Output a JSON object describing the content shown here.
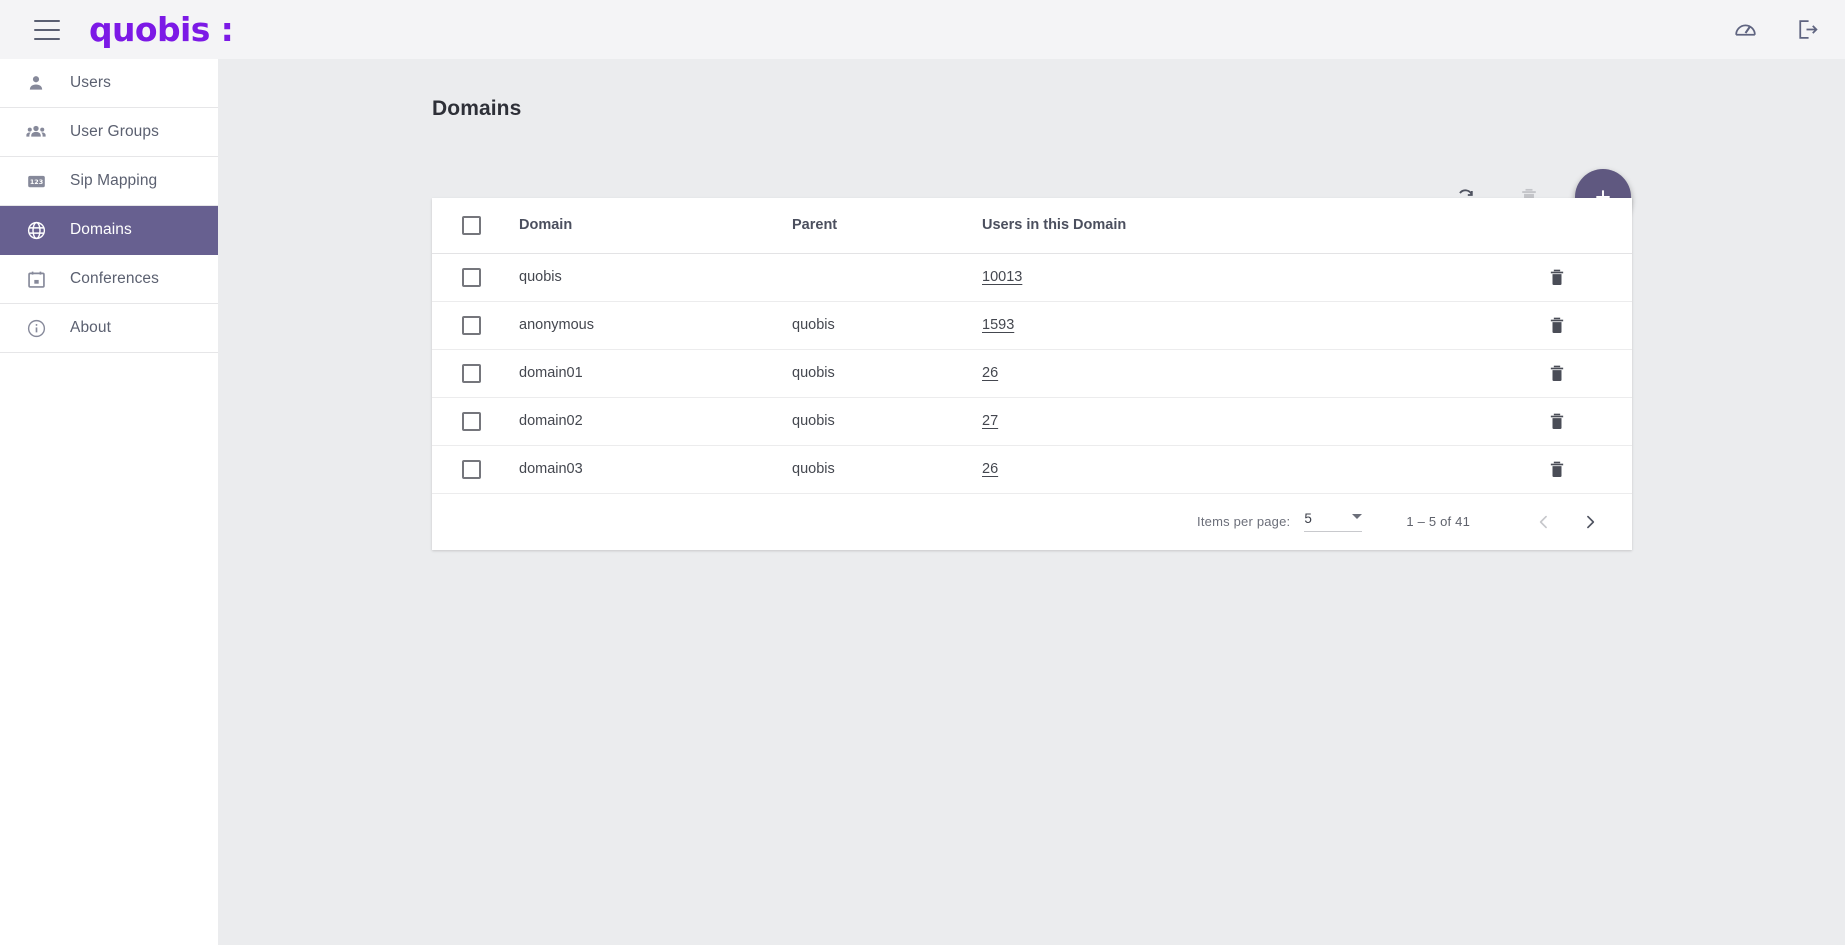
{
  "topbar": {
    "menu_icon": "hamburger-menu-icon",
    "logo_text": "quobis :",
    "actions": [
      {
        "name": "dashboard-gauge-icon",
        "label": "Dashboard"
      },
      {
        "name": "logout-icon",
        "label": "Logout"
      }
    ]
  },
  "sidebar": {
    "items": [
      {
        "label": "Users",
        "icon": "person-icon",
        "active": false
      },
      {
        "label": "User Groups",
        "icon": "people-icon",
        "active": false
      },
      {
        "label": "Sip Mapping",
        "icon": "123-icon",
        "active": false
      },
      {
        "label": "Domains",
        "icon": "globe-icon",
        "active": true
      },
      {
        "label": "Conferences",
        "icon": "calendar-icon",
        "active": false
      },
      {
        "label": "About",
        "icon": "info-icon",
        "active": false
      }
    ]
  },
  "main": {
    "page_title": "Domains",
    "toolbar": {
      "refresh_label": "Refresh",
      "delete_label": "Delete selected",
      "add_label": "+"
    },
    "table": {
      "columns": [
        "Domain",
        "Parent",
        "Users in this Domain"
      ],
      "rows": [
        {
          "domain": "quobis",
          "parent": "",
          "users": "10013"
        },
        {
          "domain": "anonymous",
          "parent": "quobis",
          "users": "1593"
        },
        {
          "domain": "domain01",
          "parent": "quobis",
          "users": "26"
        },
        {
          "domain": "domain02",
          "parent": "quobis",
          "users": "27"
        },
        {
          "domain": "domain03",
          "parent": "quobis",
          "users": "26"
        }
      ]
    },
    "paginator": {
      "items_per_page_label": "Items per page:",
      "items_per_page_value": "5",
      "range_label": "1 – 5 of 41",
      "prev_label": "Previous page",
      "next_label": "Next page"
    }
  },
  "colors": {
    "brand_purple": "#7c19e6",
    "accent_muted_purple": "#5f5880",
    "sidebar_active": "#676090",
    "page_bg": "#ebecee",
    "topbar_bg": "#f4f4f6"
  }
}
